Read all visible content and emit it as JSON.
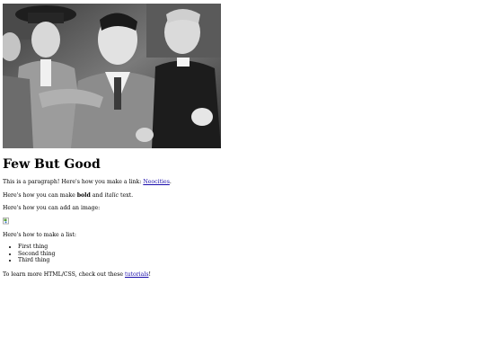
{
  "heading": "Few But Good",
  "p1": {
    "before": "This is a paragraph! Here's how you make a link: ",
    "link": "Neocities",
    "after": "."
  },
  "p2": {
    "before": "Here's how you can make ",
    "bold": "bold",
    "middle": " and ",
    "italic": "italic",
    "after": " text."
  },
  "p3": "Here's how you can add an image:",
  "p4": "Here's how to make a list:",
  "list": [
    "First thing",
    "Second thing",
    "Third thing"
  ],
  "p5": {
    "before": "To learn more HTML/CSS, check out these ",
    "link": "tutorials",
    "after": "!"
  },
  "colors": {
    "link": "#1a0dab",
    "text": "#000000",
    "background": "#ffffff"
  },
  "icons": {
    "broken_image": "broken-image-icon"
  }
}
